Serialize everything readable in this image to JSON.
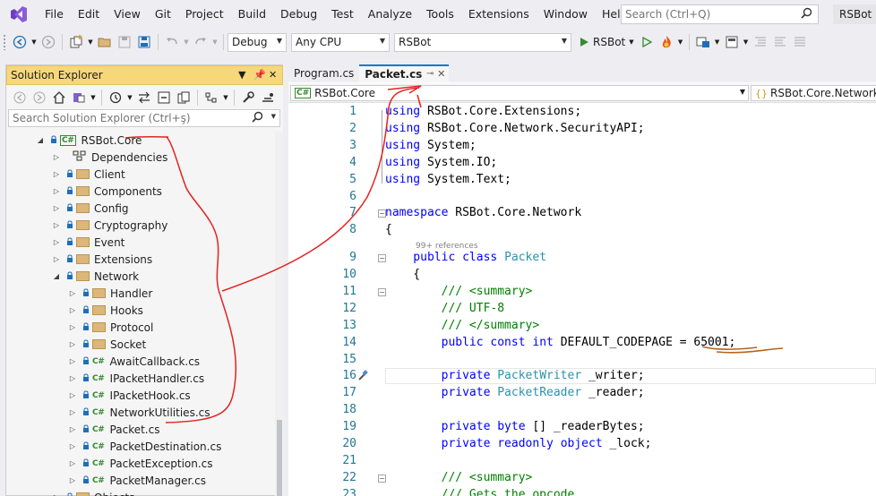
{
  "menubar": {
    "items": [
      "File",
      "Edit",
      "View",
      "Git",
      "Project",
      "Build",
      "Debug",
      "Test",
      "Analyze",
      "Tools",
      "Extensions",
      "Window",
      "Help"
    ],
    "search_placeholder": "Search (Ctrl+Q)",
    "solution_name": "RSBot"
  },
  "toolbar": {
    "configuration": "Debug",
    "platform": "Any CPU",
    "startup_project": "RSBot",
    "run_label": "RSBot"
  },
  "solution_explorer": {
    "title": "Solution Explorer",
    "search_placeholder": "Search Solution Explorer (Ctrl+ş)",
    "tree": [
      {
        "label": "RSBot.Core",
        "kind": "project",
        "depth": 0,
        "state": "expanded"
      },
      {
        "label": "Dependencies",
        "kind": "deps",
        "depth": 1,
        "state": "collapsed"
      },
      {
        "label": "Client",
        "kind": "folder",
        "depth": 1,
        "state": "collapsed"
      },
      {
        "label": "Components",
        "kind": "folder",
        "depth": 1,
        "state": "collapsed"
      },
      {
        "label": "Config",
        "kind": "folder",
        "depth": 1,
        "state": "collapsed"
      },
      {
        "label": "Cryptography",
        "kind": "folder",
        "depth": 1,
        "state": "collapsed"
      },
      {
        "label": "Event",
        "kind": "folder",
        "depth": 1,
        "state": "collapsed"
      },
      {
        "label": "Extensions",
        "kind": "folder",
        "depth": 1,
        "state": "collapsed"
      },
      {
        "label": "Network",
        "kind": "folder",
        "depth": 1,
        "state": "expanded"
      },
      {
        "label": "Handler",
        "kind": "folder",
        "depth": 2,
        "state": "collapsed"
      },
      {
        "label": "Hooks",
        "kind": "folder",
        "depth": 2,
        "state": "collapsed"
      },
      {
        "label": "Protocol",
        "kind": "folder",
        "depth": 2,
        "state": "collapsed"
      },
      {
        "label": "Socket",
        "kind": "folder",
        "depth": 2,
        "state": "collapsed"
      },
      {
        "label": "AwaitCallback.cs",
        "kind": "cs",
        "depth": 2,
        "state": "collapsed"
      },
      {
        "label": "IPacketHandler.cs",
        "kind": "cs",
        "depth": 2,
        "state": "collapsed"
      },
      {
        "label": "IPacketHook.cs",
        "kind": "cs",
        "depth": 2,
        "state": "collapsed"
      },
      {
        "label": "NetworkUtilities.cs",
        "kind": "cs",
        "depth": 2,
        "state": "collapsed"
      },
      {
        "label": "Packet.cs",
        "kind": "cs",
        "depth": 2,
        "state": "collapsed"
      },
      {
        "label": "PacketDestination.cs",
        "kind": "cs",
        "depth": 2,
        "state": "collapsed"
      },
      {
        "label": "PacketException.cs",
        "kind": "cs",
        "depth": 2,
        "state": "collapsed"
      },
      {
        "label": "PacketManager.cs",
        "kind": "cs",
        "depth": 2,
        "state": "collapsed"
      },
      {
        "label": "Objects",
        "kind": "folder",
        "depth": 1,
        "state": "collapsed"
      }
    ]
  },
  "editor": {
    "tabs": [
      {
        "label": "Program.cs",
        "active": false
      },
      {
        "label": "Packet.cs",
        "active": true
      }
    ],
    "nav_project": "RSBot.Core",
    "nav_type": "RSBot.Core.Network.P",
    "codelens": "99+ references",
    "lines": [
      {
        "n": "1",
        "tokens": [
          [
            "kw",
            "using"
          ],
          [
            "",
            "RSBot.Core.Extensions;"
          ]
        ]
      },
      {
        "n": "2",
        "tokens": [
          [
            "kw",
            "using"
          ],
          [
            "",
            "RSBot.Core.Network.SecurityAPI;"
          ]
        ]
      },
      {
        "n": "3",
        "tokens": [
          [
            "kw",
            "using"
          ],
          [
            "",
            "System;"
          ]
        ]
      },
      {
        "n": "4",
        "tokens": [
          [
            "kw",
            "using"
          ],
          [
            "",
            "System.IO;"
          ]
        ]
      },
      {
        "n": "5",
        "tokens": [
          [
            "kw",
            "using"
          ],
          [
            "",
            "System.Text;"
          ]
        ]
      },
      {
        "n": "6",
        "tokens": []
      },
      {
        "n": "7",
        "tokens": [
          [
            "kw",
            "namespace"
          ],
          [
            "",
            "RSBot.Core.Network"
          ]
        ]
      },
      {
        "n": "8",
        "tokens": [
          [
            "",
            "{"
          ]
        ]
      },
      {
        "n": "9",
        "tokens": [
          [
            "kw",
            "    public"
          ],
          [
            "kw",
            "class"
          ],
          [
            "ty",
            "Packet"
          ]
        ]
      },
      {
        "n": "10",
        "tokens": [
          [
            "",
            "    {"
          ]
        ]
      },
      {
        "n": "11",
        "tokens": [
          [
            "cm",
            "        /// <summary>"
          ]
        ]
      },
      {
        "n": "12",
        "tokens": [
          [
            "cm",
            "        /// UTF-8"
          ]
        ]
      },
      {
        "n": "13",
        "tokens": [
          [
            "cm",
            "        /// </summary>"
          ]
        ]
      },
      {
        "n": "14",
        "tokens": [
          [
            "kw",
            "        public"
          ],
          [
            "kw",
            "const"
          ],
          [
            "kw",
            "int"
          ],
          [
            "",
            "DEFAULT_CODEPAGE = 65001;"
          ]
        ]
      },
      {
        "n": "15",
        "tokens": []
      },
      {
        "n": "16",
        "tokens": [
          [
            "kw",
            "        private"
          ],
          [
            "ty",
            "PacketWriter"
          ],
          [
            "",
            "_writer;"
          ]
        ]
      },
      {
        "n": "17",
        "tokens": [
          [
            "kw",
            "        private"
          ],
          [
            "ty",
            "PacketReader"
          ],
          [
            "",
            "_reader;"
          ]
        ]
      },
      {
        "n": "18",
        "tokens": []
      },
      {
        "n": "19",
        "tokens": [
          [
            "kw",
            "        private"
          ],
          [
            "kw",
            "byte"
          ],
          [
            "",
            "[] _readerBytes;"
          ]
        ]
      },
      {
        "n": "20",
        "tokens": [
          [
            "kw",
            "        private"
          ],
          [
            "kw",
            "readonly"
          ],
          [
            "kw",
            "object"
          ],
          [
            "",
            "_lock;"
          ]
        ]
      },
      {
        "n": "21",
        "tokens": []
      },
      {
        "n": "22",
        "tokens": [
          [
            "cm",
            "        /// <summary>"
          ]
        ]
      },
      {
        "n": "23",
        "tokens": [
          [
            "cm",
            "        /// Gets the opcode."
          ]
        ]
      }
    ]
  },
  "colors": {
    "accent": "#007acc",
    "keyword": "#0000ff",
    "type": "#2b91af",
    "comment": "#008000",
    "line_number": "#237893",
    "annotation_red": "#e52222",
    "annotation_brown": "#b5651d"
  }
}
